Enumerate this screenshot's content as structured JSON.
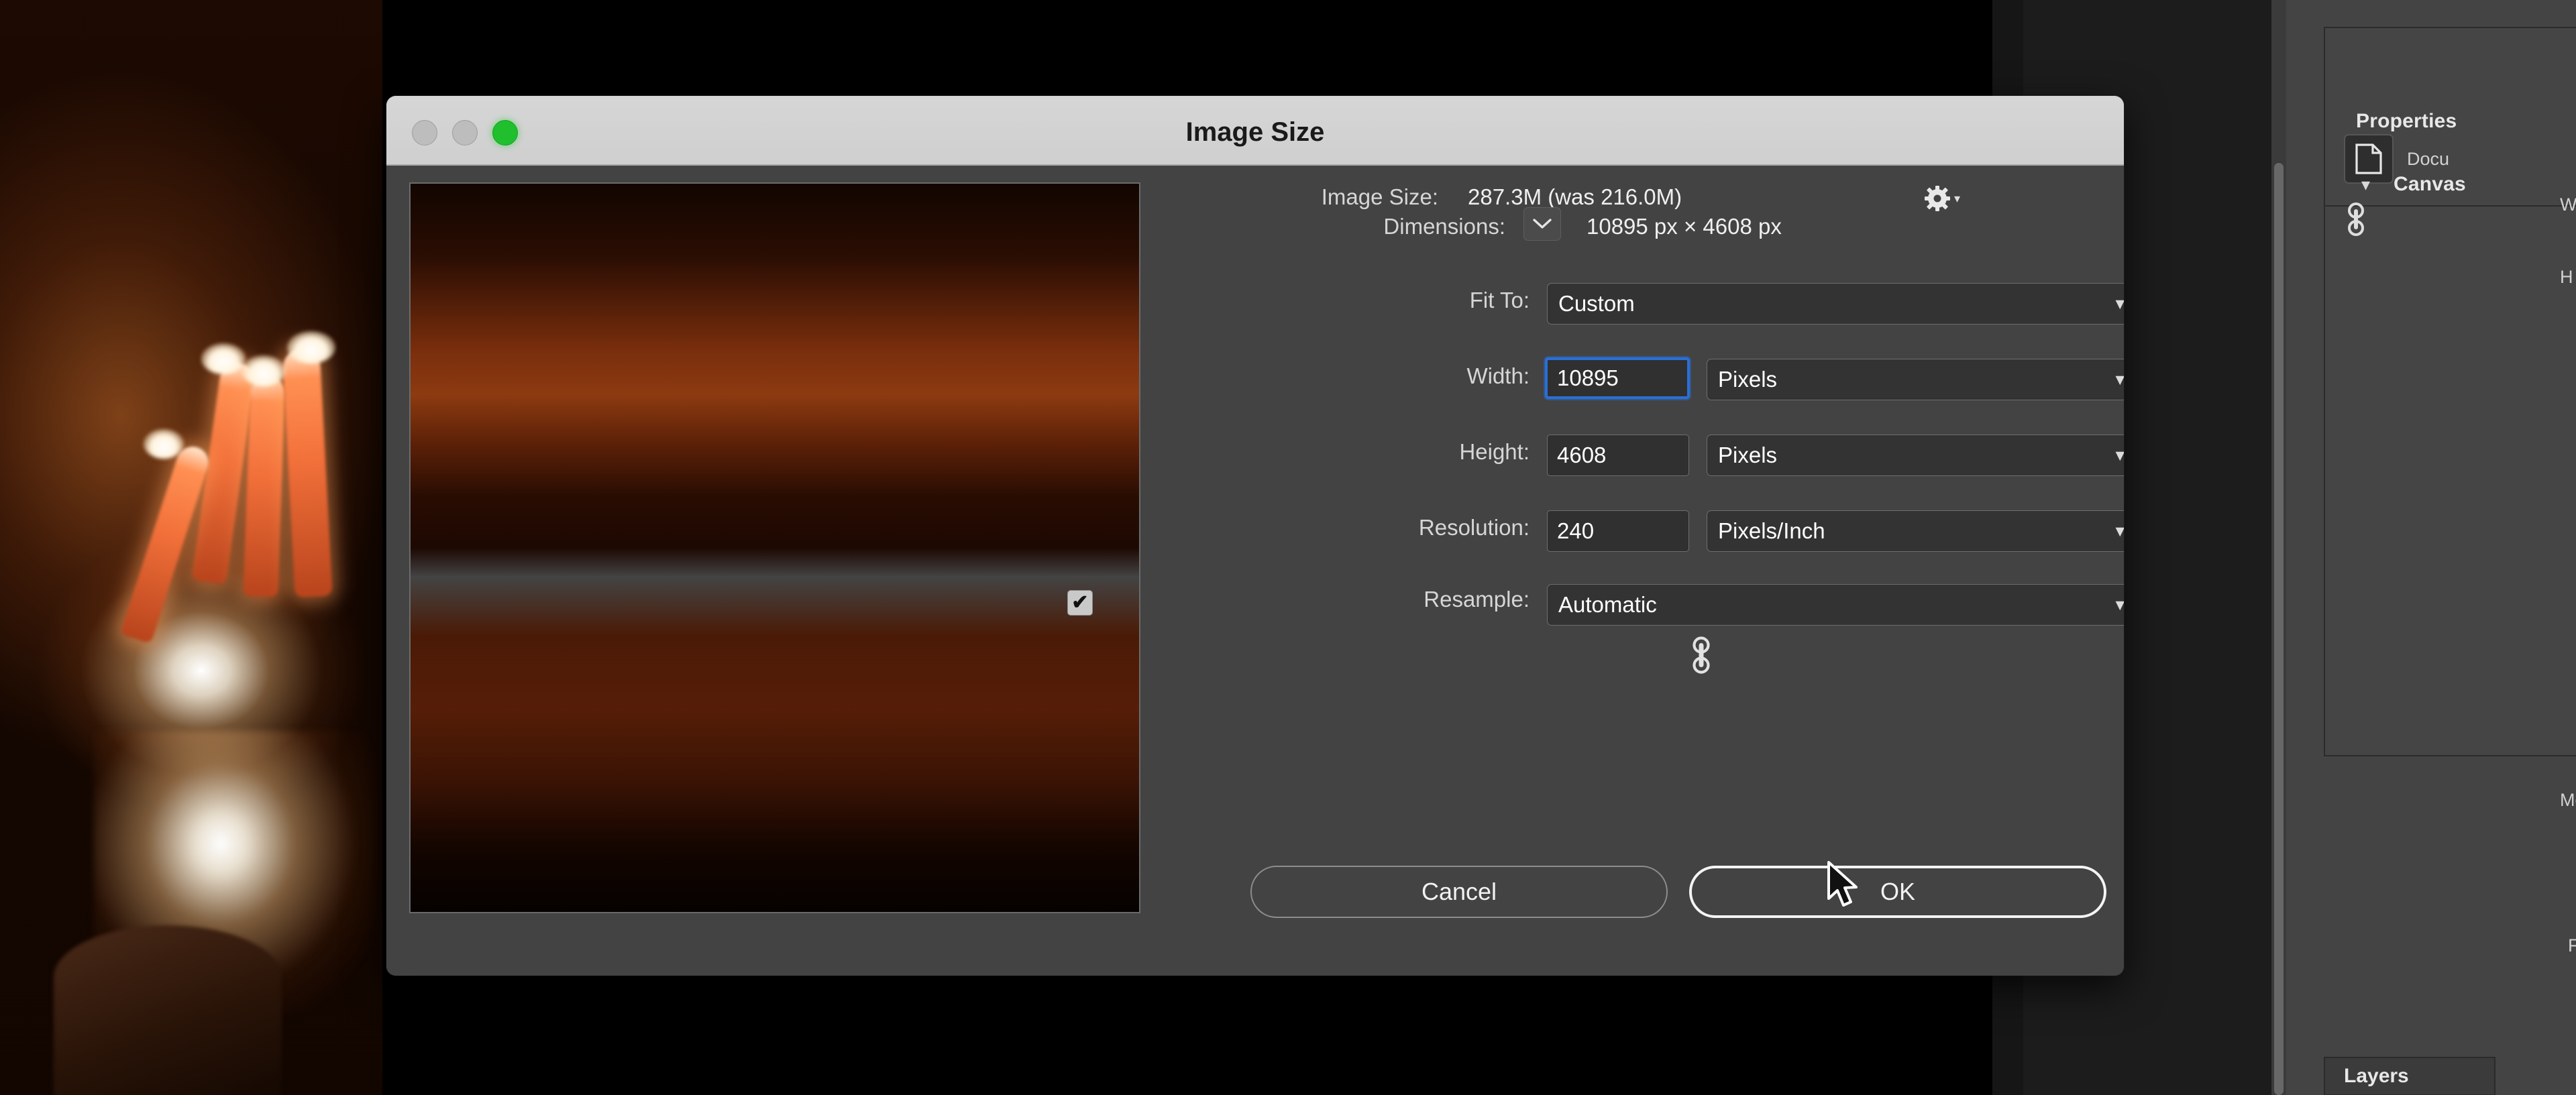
{
  "app": {
    "background_panels": {
      "properties_title": "Properties",
      "document_label": "Docu",
      "document_icon": "document-icon",
      "canvas_section": "Canvas",
      "canvas_chevron_icon": "chevron-down-icon",
      "canvas_link_icon": "link-icon",
      "canvas_width_label": "W",
      "canvas_height_label": "H",
      "mode_label": "Mode",
      "fill_label": "Fill",
      "layers_tab": "Layers"
    }
  },
  "dialog": {
    "title": "Image Size",
    "window_controls": {
      "close": "close-button",
      "minimize": "minimize-button",
      "zoom": "zoom-button"
    },
    "preview": {
      "name": "image-preview"
    },
    "image_size": {
      "label": "Image Size:",
      "value": "287.3M (was 216.0M)",
      "gear_icon": "gear-icon",
      "gear_caret_icon": "caret-down-icon"
    },
    "dimensions": {
      "label": "Dimensions:",
      "disclosure_icon": "chevron-down-icon",
      "value": "10895 px  ×  4608 px"
    },
    "fit_to": {
      "label": "Fit To:",
      "value": "Custom",
      "caret_icon": "chevron-down-icon"
    },
    "width": {
      "label": "Width:",
      "value": "10895",
      "unit": "Pixels",
      "caret_icon": "chevron-down-icon",
      "focused": true
    },
    "height": {
      "label": "Height:",
      "value": "4608",
      "unit": "Pixels",
      "caret_icon": "chevron-down-icon"
    },
    "resolution": {
      "label": "Resolution:",
      "value": "240",
      "unit": "Pixels/Inch",
      "caret_icon": "chevron-down-icon"
    },
    "resample": {
      "label": "Resample:",
      "checked_glyph": "✔",
      "value": "Automatic",
      "caret_icon": "chevron-down-icon"
    },
    "link_icon": "link-constrain-icon",
    "buttons": {
      "cancel": "Cancel",
      "ok": "OK"
    }
  },
  "colors": {
    "dialog_bg": "#434343",
    "titlebar_bg": "#d2d2d2",
    "focus_blue": "#2a6fd6",
    "green_traffic": "#1fbf2e",
    "panel_bg": "#454545"
  },
  "cursor": {
    "icon": "arrow-cursor"
  }
}
